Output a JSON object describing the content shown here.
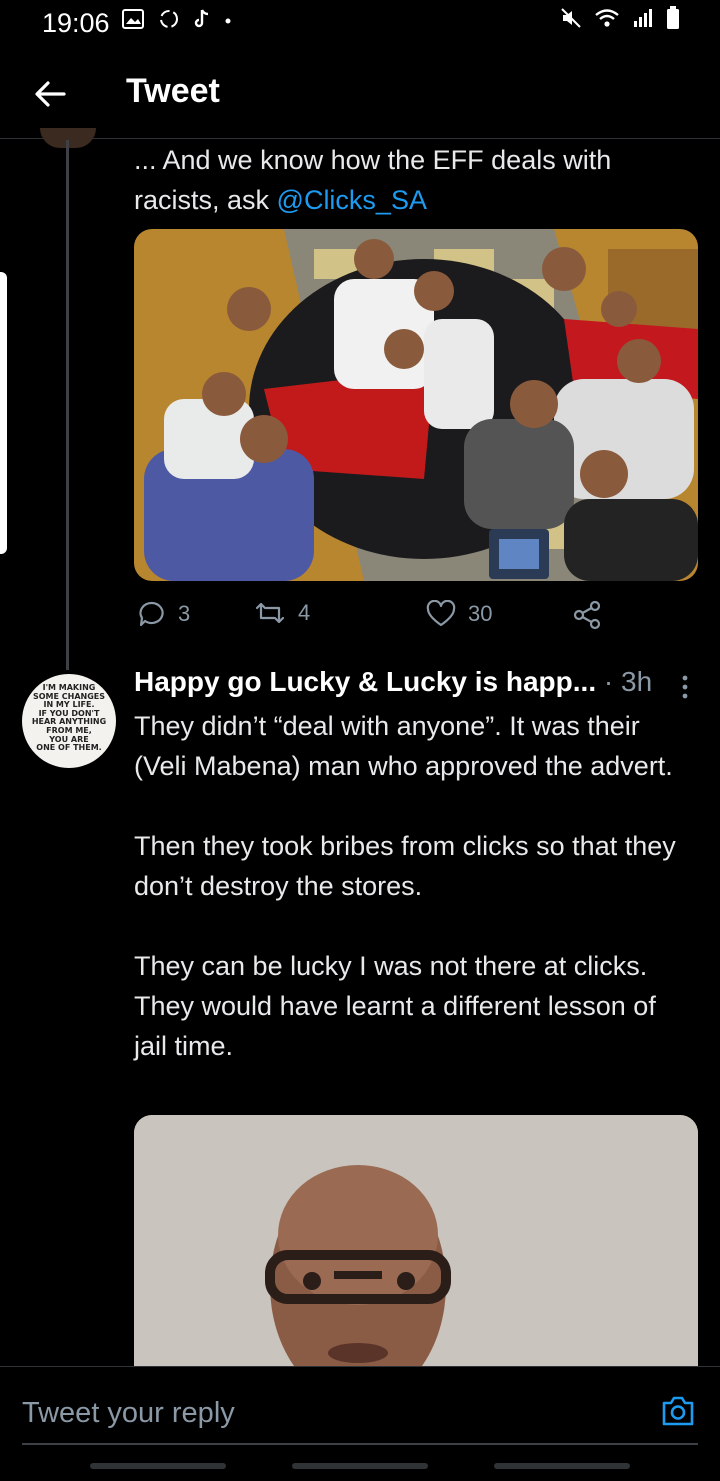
{
  "status_bar": {
    "time": "19:06"
  },
  "header": {
    "title": "Tweet"
  },
  "tweet": {
    "text_prefix": "... And we know how the EFF deals with racists, ask ",
    "mention": "@Clicks_SA",
    "stats": {
      "replies": "3",
      "retweets": "4",
      "likes": "30"
    }
  },
  "reply": {
    "author": "Happy go Lucky & Lucky is happ...",
    "separator": "·",
    "time": "3h",
    "avatar_text": [
      "I'M MAKING",
      "SOME CHANGES",
      "IN MY LIFE.",
      "IF YOU DON'T",
      "HEAR ANYTHING",
      "FROM ME,",
      "YOU ARE",
      "ONE OF THEM."
    ],
    "paragraphs": [
      "They didn’t “deal with anyone”. It was their (Veli Mabena) man who approved the advert.",
      "Then they took bribes from clicks so that they don’t destroy the stores.",
      "They can be lucky I was not there at clicks. They would have learnt a different lesson of jail time."
    ]
  },
  "composer": {
    "placeholder": "Tweet your reply"
  },
  "icons": [
    "gallery-icon",
    "sync-icon",
    "tiktok-icon",
    "mute-icon",
    "wifi-icon",
    "signal-icon",
    "battery-icon",
    "back-arrow-icon",
    "reply-icon",
    "retweet-icon",
    "like-icon",
    "share-icon",
    "more-icon",
    "camera-icon"
  ],
  "colors": {
    "background": "#000000",
    "link": "#1d9bf0",
    "muted": "#8b98a5"
  }
}
